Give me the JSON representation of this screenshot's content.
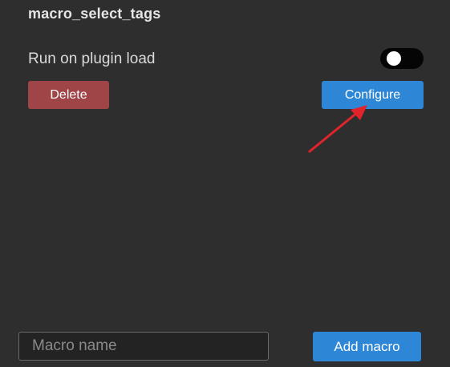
{
  "macro": {
    "name": "macro_select_tags",
    "run_on_load_label": "Run on plugin load",
    "run_on_load_enabled": false,
    "delete_label": "Delete",
    "configure_label": "Configure"
  },
  "footer": {
    "macro_name_placeholder": "Macro name",
    "macro_name_value": "",
    "add_label": "Add macro"
  },
  "colors": {
    "background": "#2e2e2e",
    "delete_button": "#a04547",
    "primary_button": "#2d86d6",
    "toggle_track": "#050505",
    "annotation_arrow": "#e0242c"
  },
  "icons": {
    "annotation": "red-arrow-icon"
  }
}
